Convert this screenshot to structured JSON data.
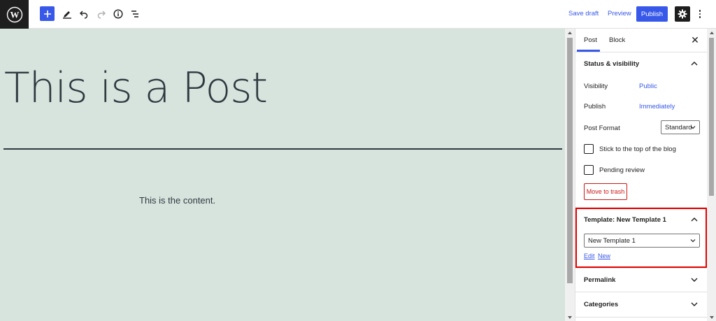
{
  "topbar": {
    "logo_icon": "wordpress-logo",
    "icons": [
      "plus-icon",
      "pencil-icon",
      "undo-icon",
      "redo-icon",
      "info-icon",
      "list-view-icon",
      "gear-icon",
      "more-vertical-icon"
    ],
    "save_draft": "Save draft",
    "preview": "Preview",
    "publish": "Publish"
  },
  "editor": {
    "title": "This is a Post",
    "content": "This is the content.",
    "background": "#d7e3dd"
  },
  "sidebar": {
    "tabs": [
      {
        "label": "Post",
        "active": true
      },
      {
        "label": "Block",
        "active": false
      }
    ],
    "status": {
      "title": "Status & visibility",
      "visibility_label": "Visibility",
      "visibility_value": "Public",
      "publish_label": "Publish",
      "publish_value": "Immediately",
      "format_label": "Post Format",
      "format_value": "Standard",
      "stick_label": "Stick to the top of the blog",
      "pending_label": "Pending review",
      "trash": "Move to trash"
    },
    "template": {
      "title": "Template: New Template 1",
      "selected": "New Template 1",
      "edit": "Edit",
      "new": "New"
    },
    "permalink": "Permalink",
    "categories": "Categories"
  },
  "colors": {
    "accent": "#3858e9",
    "danger": "#cc1818",
    "highlight": "#e60000"
  }
}
